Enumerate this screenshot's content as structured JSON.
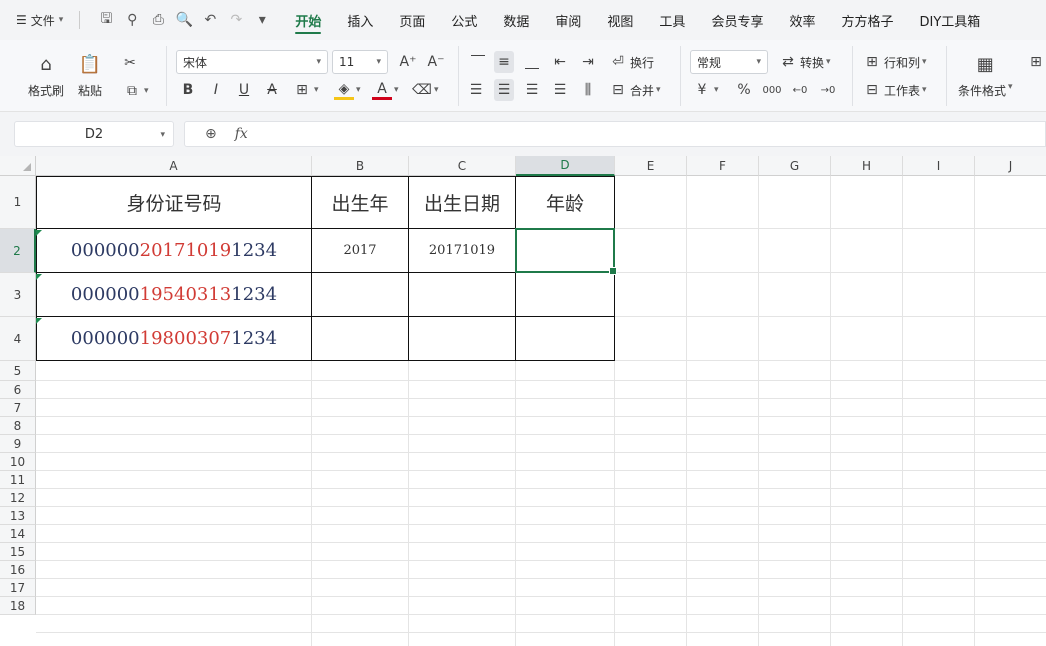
{
  "menu": {
    "file_label": "文件",
    "tabs": [
      "开始",
      "插入",
      "页面",
      "公式",
      "数据",
      "审阅",
      "视图",
      "工具",
      "会员专享",
      "效率",
      "方方格子",
      "DIY工具箱"
    ],
    "active_tab": "开始"
  },
  "ribbon": {
    "format_painter": "格式刷",
    "paste": "粘贴",
    "font_name": "宋体",
    "font_size": "11",
    "wrap": "换行",
    "merge": "合并",
    "number_format": "常规",
    "convert": "转换",
    "row_col": "行和列",
    "worksheet": "工作表",
    "cond_format": "条件格式",
    "bold": "B",
    "italic": "I",
    "underline": "U",
    "strike": "A",
    "currency": "¥",
    "percent": "%",
    "thousands": "000",
    "inc_dec": "←0",
    "dec_dec": "→0",
    "font_color_accent": "#d0021b",
    "fill_color_accent": "#f5c518"
  },
  "formula_bar": {
    "name_box": "D2",
    "fx_label": "fx",
    "content": ""
  },
  "grid": {
    "columns": [
      "A",
      "B",
      "C",
      "D",
      "E",
      "F",
      "G",
      "H",
      "I",
      "J"
    ],
    "rows": [
      "1",
      "2",
      "3",
      "4",
      "5",
      "6",
      "7",
      "8",
      "9",
      "10",
      "11",
      "12",
      "13",
      "14",
      "15",
      "16",
      "17",
      "18"
    ],
    "selected_col": "D",
    "selected_row": "2",
    "headers": {
      "a1": "身份证号码",
      "b1": "出生年",
      "c1": "出生日期",
      "d1": "年龄"
    },
    "ids": [
      {
        "pre": "000000",
        "mid": "20171019",
        "post": "1234"
      },
      {
        "pre": "000000",
        "mid": "19540313",
        "post": "1234"
      },
      {
        "pre": "000000",
        "mid": "19800307",
        "post": "1234"
      }
    ],
    "b2": "2017",
    "c2": "20171019"
  }
}
